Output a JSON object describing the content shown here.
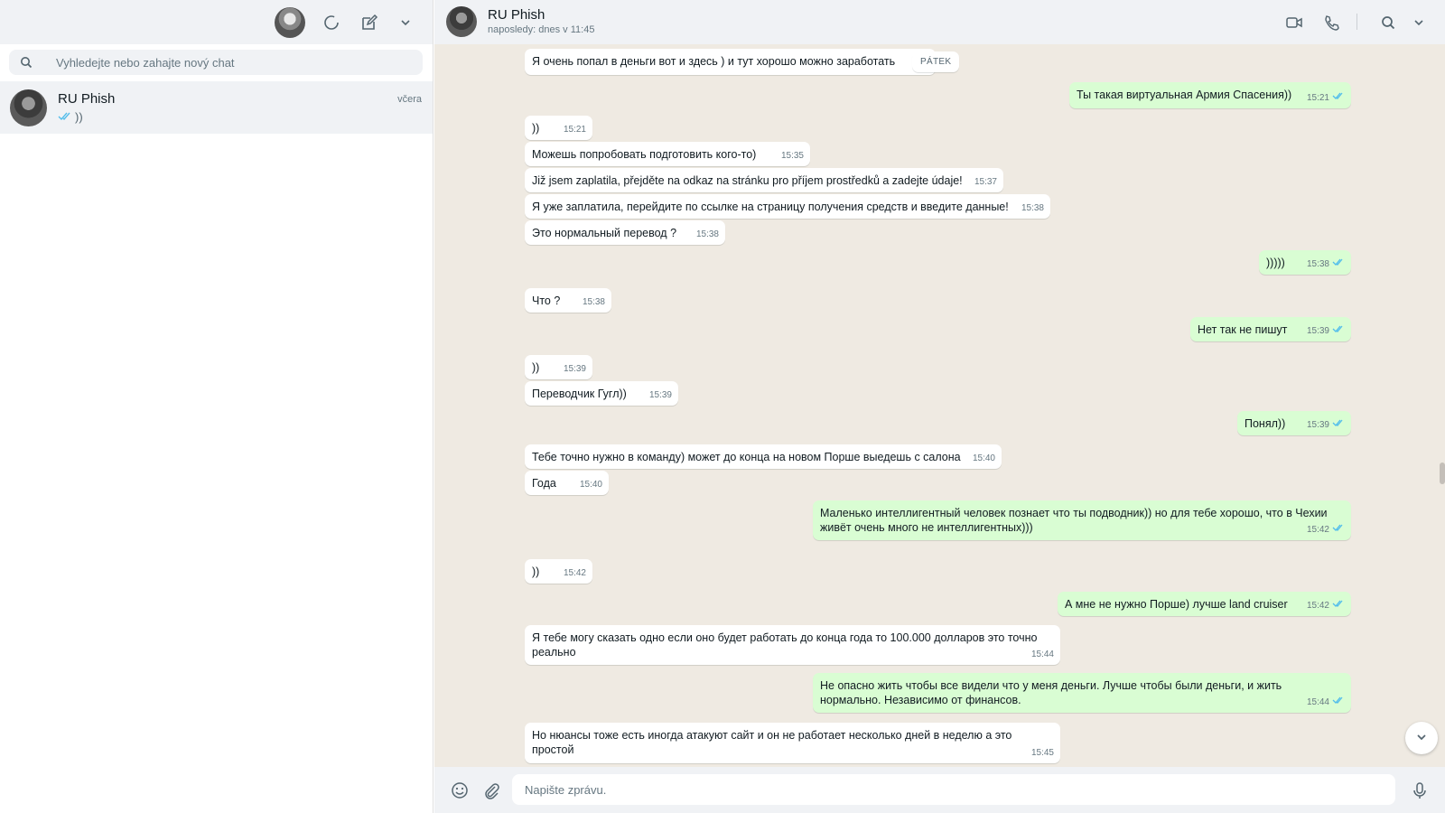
{
  "sidebar": {
    "search": {
      "placeholder": "Vyhledejte nebo zahajte nový chat",
      "value": ""
    },
    "chats": [
      {
        "name": "RU Phish",
        "time": "včera",
        "preview": "))"
      }
    ]
  },
  "conversation": {
    "contact_name": "RU Phish",
    "status": "naposledy: dnes v 11:45",
    "day_badge": "PÁTEK",
    "messages": [
      {
        "dir": "in",
        "text": "Я очень попал в деньги вот и здесь ) и тут хорошо можно заработать",
        "time": ""
      },
      {
        "dir": "out",
        "text": "Ты такая виртуальная Армия Спасения))",
        "time": "15:21"
      },
      {
        "dir": "in",
        "text": "))",
        "time": "15:21"
      },
      {
        "dir": "in",
        "text": "Можешь попробовать подготовить кого-то)",
        "time": "15:35"
      },
      {
        "dir": "in",
        "text": "Již jsem zaplatila, přejděte na odkaz na stránku pro příjem prostředků a zadejte údaje!",
        "time": "15:37"
      },
      {
        "dir": "in",
        "text": "Я уже заплатила, перейдите по ссылке на страницу получения средств и введите данные!",
        "time": "15:38"
      },
      {
        "dir": "in",
        "text": "Это нормальный перевод ?",
        "time": "15:38"
      },
      {
        "dir": "out",
        "text": ")))))",
        "time": "15:38"
      },
      {
        "dir": "in",
        "text": "Что ?",
        "time": "15:38"
      },
      {
        "dir": "out",
        "text": "Нет так не пишут",
        "time": "15:39"
      },
      {
        "dir": "in",
        "text": "))",
        "time": "15:39"
      },
      {
        "dir": "in",
        "text": "Переводчик Гугл))",
        "time": "15:39"
      },
      {
        "dir": "out",
        "text": "Понял))",
        "time": "15:39"
      },
      {
        "dir": "in",
        "text": "Тебе точно нужно в команду) может до конца на новом Порше выедешь с салона",
        "time": "15:40"
      },
      {
        "dir": "in",
        "text": "Года",
        "time": "15:40"
      },
      {
        "dir": "out",
        "text": "Маленько интеллигентный человек познает что ты  подводник)) но для тебе хорошо, что в Чехии живёт очень много не интеллигентных)))",
        "time": "15:42"
      },
      {
        "dir": "in",
        "text": "))",
        "time": "15:42"
      },
      {
        "dir": "out",
        "text": "А мне не нужно Порше) лучше land cruiser",
        "time": "15:42"
      },
      {
        "dir": "in",
        "text": "Я тебе могу сказать одно если оно будет работать до конца года то 100.000 долларов это точно реально",
        "time": "15:44"
      },
      {
        "dir": "out",
        "text": "Не опасно жить чтобы все видели что у меня деньги. Лучше чтобы были деньги, и жить нормально. Независимо от финансов.",
        "time": "15:44"
      },
      {
        "dir": "in",
        "text": "Но нюансы тоже есть иногда атакуют сайт и он не работает несколько дней в неделю а это простой",
        "time": "15:45"
      }
    ]
  },
  "composer": {
    "placeholder": "Napište zprávu.",
    "value": ""
  },
  "colors": {
    "outgoing": "#d9fdd3",
    "incoming": "#ffffff",
    "read_ticks": "#53bdeb",
    "panel": "#f0f2f5",
    "chat_bg": "#efeae2"
  },
  "icons": [
    "status-icon",
    "new-chat-icon",
    "menu-chevron-icon",
    "search-icon",
    "video-call-icon",
    "phone-icon",
    "emoji-icon",
    "attach-icon",
    "mic-icon",
    "scroll-down-icon"
  ]
}
